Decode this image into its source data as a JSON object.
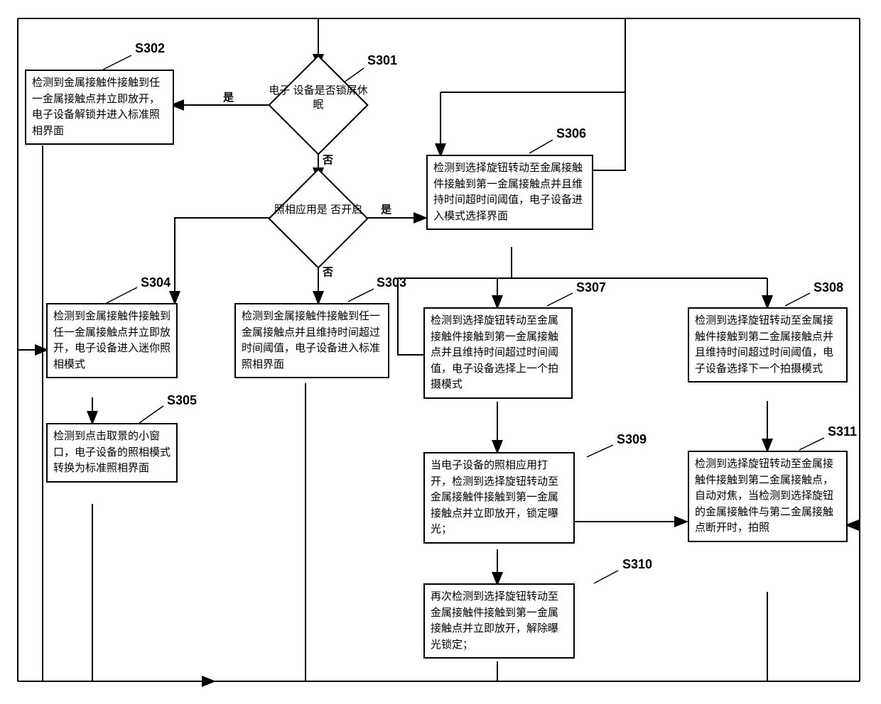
{
  "labels": {
    "s301": "S301",
    "s302": "S302",
    "s303": "S303",
    "s304": "S304",
    "s305": "S305",
    "s306": "S306",
    "s307": "S307",
    "s308": "S308",
    "s309": "S309",
    "s310": "S310",
    "s311": "S311"
  },
  "decisions": {
    "d1": "电子\n设备是否锁屏休\n眠",
    "d2": "照相应用是\n否开启"
  },
  "edges": {
    "yes1": "是",
    "no1": "否",
    "yes2": "是",
    "no2": "否"
  },
  "boxes": {
    "s302": "检测到金属接触件接触到任一金属接触点并立即放开，电子设备解锁并进入标准照相界面",
    "s303": "检测到金属接触件接触到任一金属接触点并且维持时间超过时间阈值，电子设备进入标准照相界面",
    "s304": "检测到金属接触件接触到任一金属接触点并立即放开，电子设备进入迷你照相模式",
    "s305": "检测到点击取景的小窗口，电子设备的照相模式转换为标准照相界面",
    "s306": "检测到选择旋钮转动至金属接触件接触到第一金属接触点并且维持时间超时间阈值，电子设备进入模式选择界面",
    "s307": "检测到选择旋钮转动至金属接触件接触到第一金属接触点并且维持时间超过时间阈值，电子设备选择上一个拍摄模式",
    "s308": "检测到选择旋钮转动至金属接触件接触到第二金属接触点并且维持时间超过时间阈值，电子设备选择下一个拍摄模式",
    "s309": "当电子设备的照相应用打开，检测到选择旋钮转动至金属接触件接触到第一金属接触点并立即放开，锁定曝光；",
    "s310": "再次检测到选择旋钮转动至金属接触件接触到第一金属接触点并立即放开，解除曝光锁定；",
    "s311": "检测到选择旋钮转动至金属接触件接触到第二金属接触点，自动对焦，当检测到选择旋钮的金属接触件与第二金属接触点断开时，拍照"
  }
}
